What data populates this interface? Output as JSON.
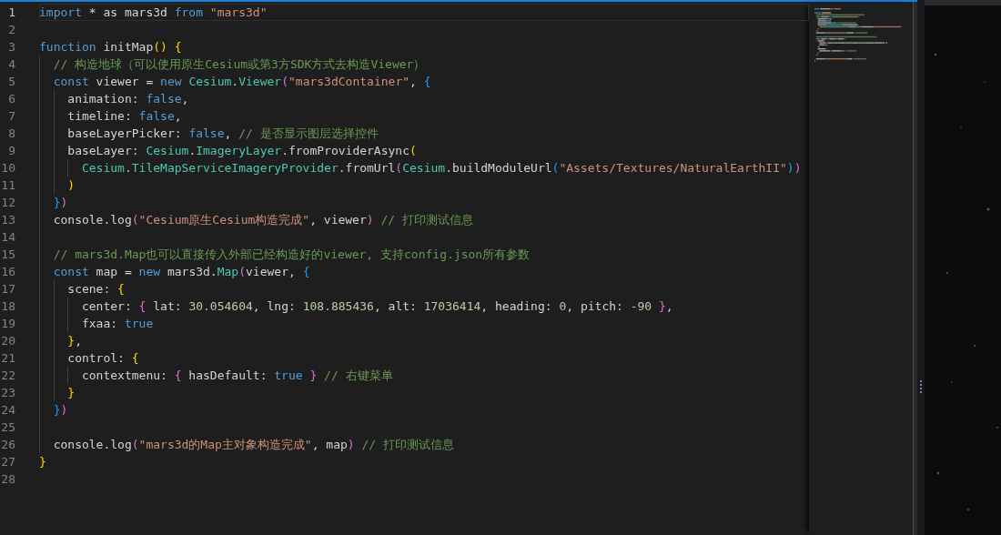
{
  "editor": {
    "lines": [
      {
        "number": "1",
        "current": true,
        "tokens": [
          {
            "kind": "keyword",
            "text": "import"
          },
          {
            "kind": "plain",
            "text": " * as mars3d "
          },
          {
            "kind": "keyword",
            "text": "from"
          },
          {
            "kind": "string",
            "text": " \"mars3d\""
          }
        ]
      },
      {
        "number": "2",
        "current": false
      },
      {
        "number": "3",
        "current": false,
        "tokens": [
          {
            "kind": "keyword",
            "text": "function"
          },
          {
            "kind": "plain",
            "text": " initMap"
          },
          {
            "kind": "bracket1",
            "text": "() {"
          }
        ]
      },
      {
        "number": "4",
        "current": false,
        "tokens": [
          {
            "kind": "comment",
            "text": "  // 构造地球（可以使用原生Cesium或第3方SDK方式去构造Viewer）"
          }
        ]
      },
      {
        "number": "5",
        "current": false,
        "tokens": [
          {
            "kind": "keyword",
            "text": "  const"
          },
          {
            "kind": "plain",
            "text": " viewer = "
          },
          {
            "kind": "keyword",
            "text": "new"
          },
          {
            "kind": "class",
            "text": " Cesium"
          },
          {
            "kind": "plain",
            "text": "."
          },
          {
            "kind": "class",
            "text": "Viewer"
          },
          {
            "kind": "bracket2",
            "text": "("
          },
          {
            "kind": "string",
            "text": "\"mars3dContainer\""
          },
          {
            "kind": "plain",
            "text": ","
          },
          {
            "kind": "bracket3",
            "text": " {"
          }
        ]
      },
      {
        "number": "6",
        "current": false,
        "tokens": [
          {
            "kind": "plain",
            "text": "    animation: "
          },
          {
            "kind": "keyword",
            "text": "false"
          },
          {
            "kind": "plain",
            "text": ","
          }
        ]
      },
      {
        "number": "7",
        "current": false,
        "tokens": [
          {
            "kind": "plain",
            "text": "    timeline: "
          },
          {
            "kind": "keyword",
            "text": "false"
          },
          {
            "kind": "plain",
            "text": ","
          }
        ]
      },
      {
        "number": "8",
        "current": false,
        "tokens": [
          {
            "kind": "plain",
            "text": "    baseLayerPicker: "
          },
          {
            "kind": "keyword",
            "text": "false"
          },
          {
            "kind": "plain",
            "text": ","
          },
          {
            "kind": "comment",
            "text": " // 是否显示图层选择控件"
          }
        ]
      },
      {
        "number": "9",
        "current": false,
        "tokens": [
          {
            "kind": "plain",
            "text": "    baseLayer: "
          },
          {
            "kind": "class",
            "text": "Cesium"
          },
          {
            "kind": "plain",
            "text": "."
          },
          {
            "kind": "class",
            "text": "ImageryLayer"
          },
          {
            "kind": "plain",
            "text": ".fromProviderAsync"
          },
          {
            "kind": "bracket1",
            "text": "("
          }
        ]
      },
      {
        "number": "10",
        "current": false,
        "tokens": [
          {
            "kind": "class",
            "text": "      Cesium"
          },
          {
            "kind": "plain",
            "text": "."
          },
          {
            "kind": "class",
            "text": "TileMapServiceImageryProvider"
          },
          {
            "kind": "plain",
            "text": ".fromUrl"
          },
          {
            "kind": "bracket2",
            "text": "("
          },
          {
            "kind": "class",
            "text": "Cesium"
          },
          {
            "kind": "plain",
            "text": ".buildModuleUrl"
          },
          {
            "kind": "bracket3",
            "text": "("
          },
          {
            "kind": "string",
            "text": "\"Assets/Textures/NaturalEarthII\""
          },
          {
            "kind": "bracket3",
            "text": ")"
          },
          {
            "kind": "bracket2",
            "text": ")"
          }
        ]
      },
      {
        "number": "11",
        "current": false,
        "tokens": [
          {
            "kind": "bracket1",
            "text": "    )"
          }
        ]
      },
      {
        "number": "12",
        "current": false,
        "tokens": [
          {
            "kind": "bracket3",
            "text": "  }"
          },
          {
            "kind": "bracket2",
            "text": ")"
          }
        ]
      },
      {
        "number": "13",
        "current": false,
        "tokens": [
          {
            "kind": "plain",
            "text": "  console.log"
          },
          {
            "kind": "bracket2",
            "text": "("
          },
          {
            "kind": "string",
            "text": "\"Cesium原生Cesium构造完成\""
          },
          {
            "kind": "plain",
            "text": ", viewer"
          },
          {
            "kind": "bracket2",
            "text": ")"
          },
          {
            "kind": "comment",
            "text": " // 打印测试信息"
          }
        ]
      },
      {
        "number": "14",
        "current": false
      },
      {
        "number": "15",
        "current": false,
        "tokens": [
          {
            "kind": "comment",
            "text": "  // mars3d.Map也可以直接传入外部已经构造好的viewer, 支持config.json所有参数"
          }
        ]
      },
      {
        "number": "16",
        "current": false,
        "tokens": [
          {
            "kind": "keyword",
            "text": "  const"
          },
          {
            "kind": "plain",
            "text": " map = "
          },
          {
            "kind": "keyword",
            "text": "new"
          },
          {
            "kind": "plain",
            "text": " mars3d."
          },
          {
            "kind": "class",
            "text": "Map"
          },
          {
            "kind": "bracket2",
            "text": "("
          },
          {
            "kind": "plain",
            "text": "viewer,"
          },
          {
            "kind": "bracket3",
            "text": " {"
          }
        ]
      },
      {
        "number": "17",
        "current": false,
        "tokens": [
          {
            "kind": "plain",
            "text": "    scene: "
          },
          {
            "kind": "bracket1",
            "text": "{"
          }
        ]
      },
      {
        "number": "18",
        "current": false,
        "tokens": [
          {
            "kind": "plain",
            "text": "      center: "
          },
          {
            "kind": "bracket2",
            "text": "{"
          },
          {
            "kind": "plain",
            "text": " lat: "
          },
          {
            "kind": "number",
            "text": "30.054604"
          },
          {
            "kind": "plain",
            "text": ", lng: "
          },
          {
            "kind": "number",
            "text": "108.885436"
          },
          {
            "kind": "plain",
            "text": ", alt: "
          },
          {
            "kind": "number",
            "text": "17036414"
          },
          {
            "kind": "plain",
            "text": ", heading: "
          },
          {
            "kind": "number",
            "text": "0"
          },
          {
            "kind": "plain",
            "text": ", pitch: "
          },
          {
            "kind": "number",
            "text": "-90"
          },
          {
            "kind": "bracket2",
            "text": " }"
          },
          {
            "kind": "plain",
            "text": ","
          }
        ]
      },
      {
        "number": "19",
        "current": false,
        "tokens": [
          {
            "kind": "plain",
            "text": "      fxaa: "
          },
          {
            "kind": "keyword",
            "text": "true"
          }
        ]
      },
      {
        "number": "20",
        "current": false,
        "tokens": [
          {
            "kind": "bracket1",
            "text": "    }"
          },
          {
            "kind": "plain",
            "text": ","
          }
        ]
      },
      {
        "number": "21",
        "current": false,
        "tokens": [
          {
            "kind": "plain",
            "text": "    control: "
          },
          {
            "kind": "bracket1",
            "text": "{"
          }
        ]
      },
      {
        "number": "22",
        "current": false,
        "tokens": [
          {
            "kind": "plain",
            "text": "      contextmenu: "
          },
          {
            "kind": "bracket2",
            "text": "{"
          },
          {
            "kind": "plain",
            "text": " hasDefault: "
          },
          {
            "kind": "keyword",
            "text": "true"
          },
          {
            "kind": "bracket2",
            "text": " }"
          },
          {
            "kind": "comment",
            "text": " // 右键菜单"
          }
        ]
      },
      {
        "number": "23",
        "current": false,
        "tokens": [
          {
            "kind": "bracket1",
            "text": "    }"
          }
        ]
      },
      {
        "number": "24",
        "current": false,
        "tokens": [
          {
            "kind": "bracket3",
            "text": "  }"
          },
          {
            "kind": "bracket2",
            "text": ")"
          }
        ]
      },
      {
        "number": "25",
        "current": false
      },
      {
        "number": "26",
        "current": false,
        "tokens": [
          {
            "kind": "plain",
            "text": "  console.log"
          },
          {
            "kind": "bracket2",
            "text": "("
          },
          {
            "kind": "string",
            "text": "\"mars3d的Map主对象构造完成\""
          },
          {
            "kind": "plain",
            "text": ", map"
          },
          {
            "kind": "bracket2",
            "text": ")"
          },
          {
            "kind": "comment",
            "text": " // 打印测试信息"
          }
        ]
      },
      {
        "number": "27",
        "current": false,
        "tokens": [
          {
            "kind": "bracket1",
            "text": "}"
          }
        ]
      },
      {
        "number": "28",
        "current": false
      }
    ]
  }
}
